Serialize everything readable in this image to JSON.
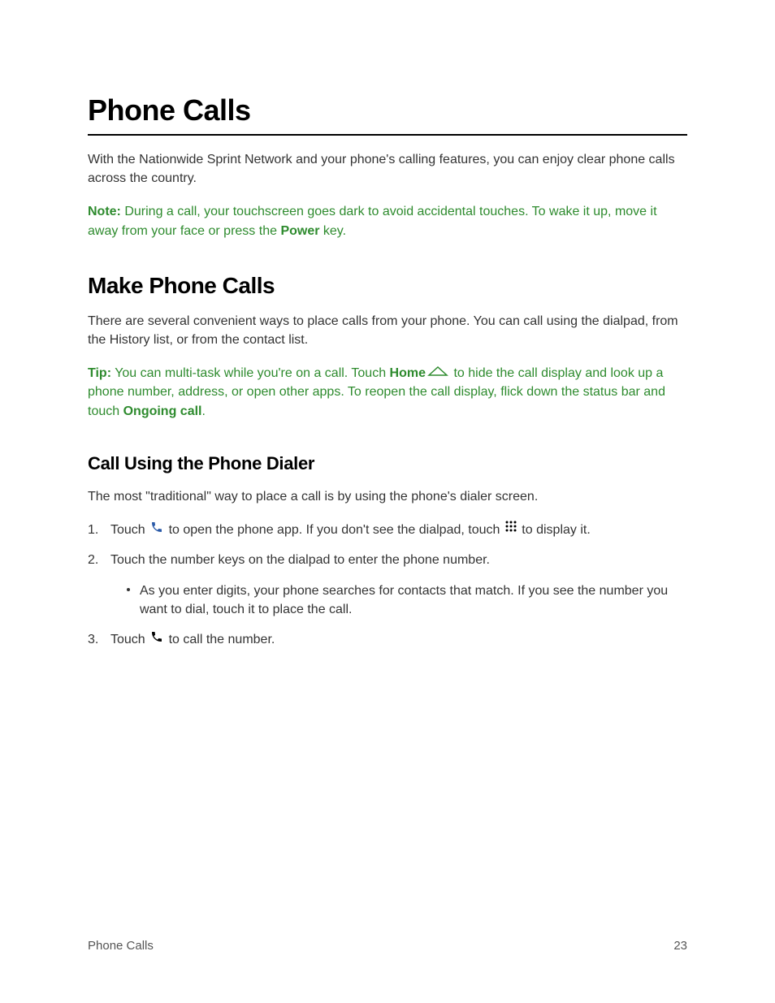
{
  "page_title": "Phone Calls",
  "intro_text": "With the Nationwide Sprint Network and your phone's calling features, you can enjoy clear phone calls across the country.",
  "note": {
    "label": "Note:",
    "text1": " During a call, your touchscreen goes dark to avoid accidental touches. To wake it up, move it away from your face or press the ",
    "bold1": "Power",
    "text2": " key."
  },
  "section1": {
    "title": "Make Phone Calls",
    "intro": "There are several convenient ways to place calls from your phone. You can call using the dialpad, from the History list, or from the contact list."
  },
  "tip": {
    "label": "Tip:",
    "text1": " You can multi-task while you're on a call. Touch ",
    "bold1": "Home",
    "text2": " to hide the call display and look up a phone number, address, or open other apps. To reopen the call display, flick down the status bar and touch ",
    "bold2": "Ongoing call",
    "text3": "."
  },
  "subsection1": {
    "title": "Call Using the Phone Dialer",
    "intro": "The most \"traditional\" way to place a call is by using the phone's dialer screen."
  },
  "steps": {
    "step1a": "Touch ",
    "step1b": " to open the phone app. If you don't see the dialpad, touch ",
    "step1c": " to display it.",
    "step2": "Touch the number keys on the dialpad to enter the phone number.",
    "step2_sub": "As you enter digits, your phone searches for contacts that match. If you see the number you want to dial, touch it to place the call.",
    "step3a": "Touch ",
    "step3b": " to call the number."
  },
  "footer": {
    "left": "Phone Calls",
    "right": "23"
  }
}
